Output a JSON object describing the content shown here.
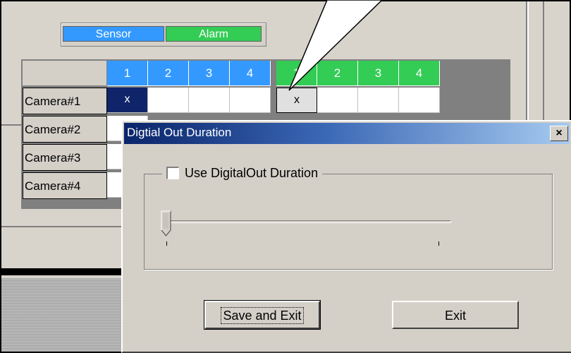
{
  "tabs": {
    "sensor_label": "Sensor",
    "alarm_label": "Alarm",
    "sensor_color": "#3399ff",
    "alarm_color": "#33cc55"
  },
  "grid": {
    "sensor_headers": [
      "1",
      "2",
      "3",
      "4"
    ],
    "alarm_headers": [
      "1",
      "2",
      "3",
      "4"
    ],
    "rows": [
      {
        "label": "Camera#1",
        "cells": [
          "x",
          "",
          "",
          "",
          "x",
          "",
          "",
          ""
        ]
      },
      {
        "label": "Camera#2",
        "cells": [
          "",
          "",
          "",
          "",
          "",
          "",
          "",
          ""
        ]
      },
      {
        "label": "Camera#3",
        "cells": [
          "",
          "",
          "",
          "",
          "",
          "",
          "",
          ""
        ]
      },
      {
        "label": "Camera#4",
        "cells": [
          "",
          "",
          "",
          "",
          "",
          "",
          "",
          ""
        ]
      }
    ]
  },
  "dialog": {
    "title": "Digtial Out Duration",
    "close_glyph": "×",
    "checkbox_label": "Use DigitalOut Duration",
    "checkbox_checked": false,
    "slider_value": 0,
    "save_label": "Save and Exit",
    "exit_label": "Exit"
  }
}
